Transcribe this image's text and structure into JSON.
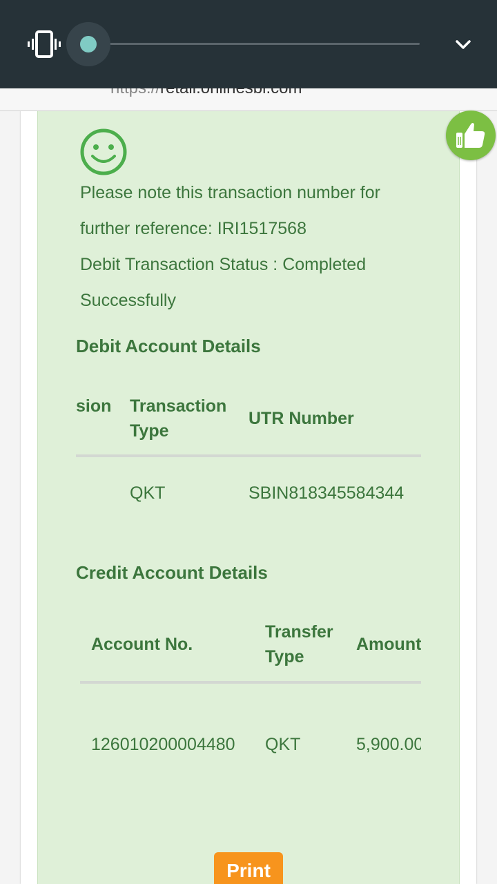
{
  "volume_panel": {
    "icon": "vibrate-icon",
    "level": 0,
    "expand_icon": "chevron-down-icon"
  },
  "browser": {
    "url_scheme": "https://",
    "url_host": "retail.onlinesbi.com"
  },
  "feedback_button": {
    "icon": "thumbs-up-icon"
  },
  "confirmation": {
    "icon": "smiley-icon",
    "line1": "Please note this transaction number for",
    "line2": "further reference: IRI1517568",
    "line3": "Debit Transaction Status : Completed",
    "line4": "Successfully"
  },
  "debit_details": {
    "title": "Debit Account Details",
    "headers": [
      "sion",
      "Transaction",
      "Type",
      "UTR Number"
    ],
    "row": [
      "QKT",
      "SBIN818345584344"
    ]
  },
  "credit_details": {
    "title": "Credit Account Details",
    "headers": [
      "Account No.",
      "Transfer",
      "Type",
      "Amount"
    ],
    "row": [
      "126010200004480",
      "QKT",
      "5,900.00"
    ]
  },
  "actions": {
    "print_label": "Print"
  },
  "colors": {
    "panel_green": "#dff0d8",
    "text_green": "#3c763d",
    "print_orange": "#f7941d",
    "volume_bg": "#263238",
    "slider_accent": "#80cbc4"
  }
}
